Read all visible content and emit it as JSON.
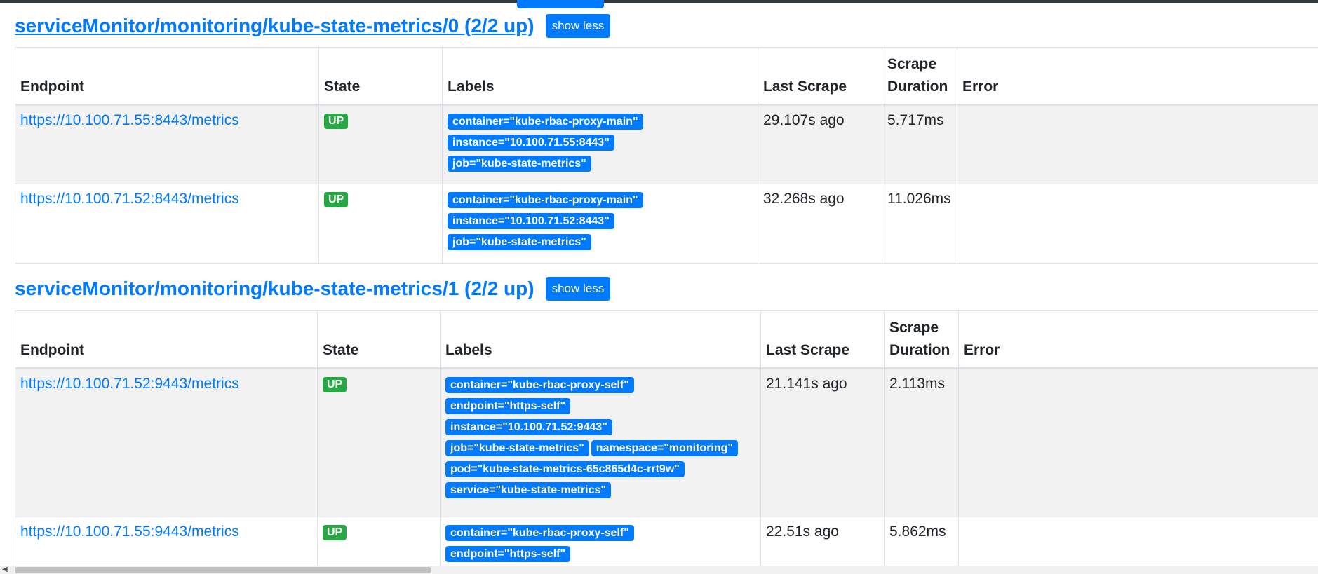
{
  "sections": [
    {
      "heading": "serviceMonitor/monitoring/kube-state-metrics/0 (2/2 up)",
      "toggle_label": "show less",
      "columns": [
        "Endpoint",
        "State",
        "Labels",
        "Last Scrape",
        "Scrape Duration",
        "Error"
      ],
      "rows": [
        {
          "endpoint": "https://10.100.71.55:8443/metrics",
          "state": "UP",
          "labels": [
            "container=\"kube-rbac-proxy-main\"",
            "instance=\"10.100.71.55:8443\"",
            "job=\"kube-state-metrics\""
          ],
          "last_scrape": "29.107s ago",
          "scrape_duration": "5.717ms",
          "error": ""
        },
        {
          "endpoint": "https://10.100.71.52:8443/metrics",
          "state": "UP",
          "labels": [
            "container=\"kube-rbac-proxy-main\"",
            "instance=\"10.100.71.52:8443\"",
            "job=\"kube-state-metrics\""
          ],
          "last_scrape": "32.268s ago",
          "scrape_duration": "11.026ms",
          "error": ""
        }
      ]
    },
    {
      "heading": "serviceMonitor/monitoring/kube-state-metrics/1 (2/2 up)",
      "toggle_label": "show less",
      "columns": [
        "Endpoint",
        "State",
        "Labels",
        "Last Scrape",
        "Scrape Duration",
        "Error"
      ],
      "rows": [
        {
          "endpoint": "https://10.100.71.52:9443/metrics",
          "state": "UP",
          "labels": [
            "container=\"kube-rbac-proxy-self\"",
            "endpoint=\"https-self\"",
            "instance=\"10.100.71.52:9443\"",
            "job=\"kube-state-metrics\"",
            "namespace=\"monitoring\"",
            "pod=\"kube-state-metrics-65c865d4c-rrt9w\"",
            "service=\"kube-state-metrics\""
          ],
          "last_scrape": "21.141s ago",
          "scrape_duration": "2.113ms",
          "error": ""
        },
        {
          "endpoint": "https://10.100.71.55:9443/metrics",
          "state": "UP",
          "labels": [
            "container=\"kube-rbac-proxy-self\"",
            "endpoint=\"https-self\""
          ],
          "last_scrape": "22.51s ago",
          "scrape_duration": "5.862ms",
          "error": ""
        }
      ]
    }
  ],
  "colors": {
    "link": "#007bff",
    "badge_up": "#28a745",
    "label_badge": "#007bff",
    "stripe": "#f2f2f2",
    "border": "#dee2e6"
  }
}
